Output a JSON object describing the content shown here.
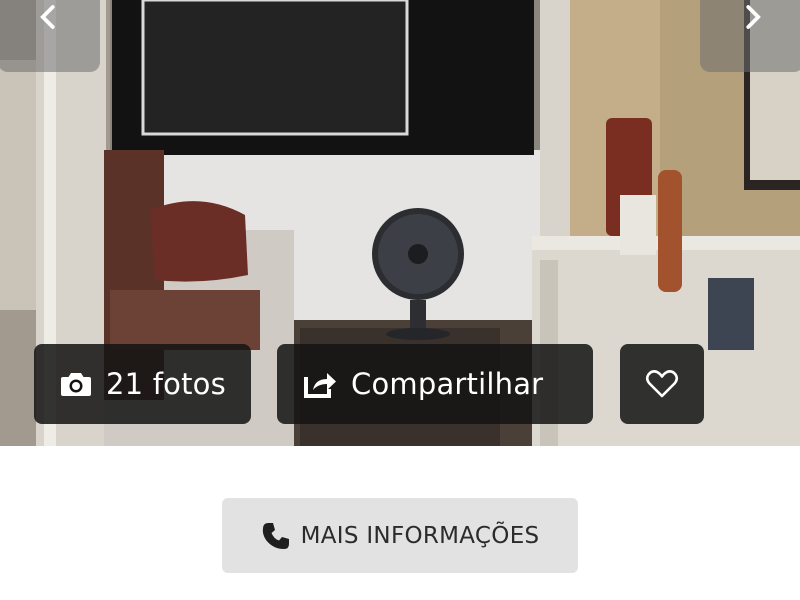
{
  "gallery": {
    "photo_description_icon": "photo",
    "prev_icon": "chevron-left-icon",
    "next_icon": "chevron-right-icon",
    "photos_button": {
      "icon": "camera-icon",
      "label": "21 fotos"
    },
    "share_button": {
      "icon": "share-icon",
      "label": "Compartilhar"
    },
    "favorite_button": {
      "icon": "heart-icon"
    }
  },
  "contact": {
    "more_info_button": {
      "icon": "phone-icon",
      "label": "MAIS INFORMAÇÕES"
    }
  },
  "colors": {
    "overlay_button_bg": "#141414",
    "more_info_bg": "#e2e2e2",
    "more_info_text": "#2b2b2b"
  }
}
